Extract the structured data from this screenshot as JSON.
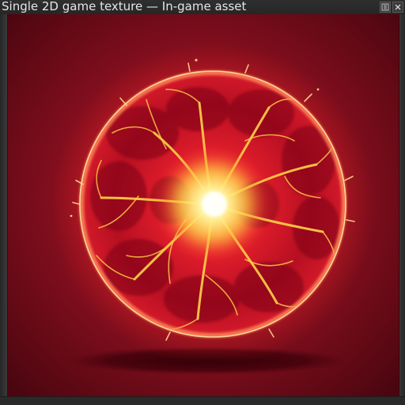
{
  "window": {
    "title": "Single 2D game texture — In-game asset",
    "controls": [
      "settings-icon",
      "close-icon"
    ]
  },
  "canvas": {
    "subject": "glowing-red-energy-orb",
    "colors": {
      "background": "#6a0c18",
      "orb": "#d0142a",
      "glow": "#ff4a3a",
      "core": "#fff6a0",
      "veins": "#ffd24a",
      "shadow": "#3a0008"
    }
  }
}
